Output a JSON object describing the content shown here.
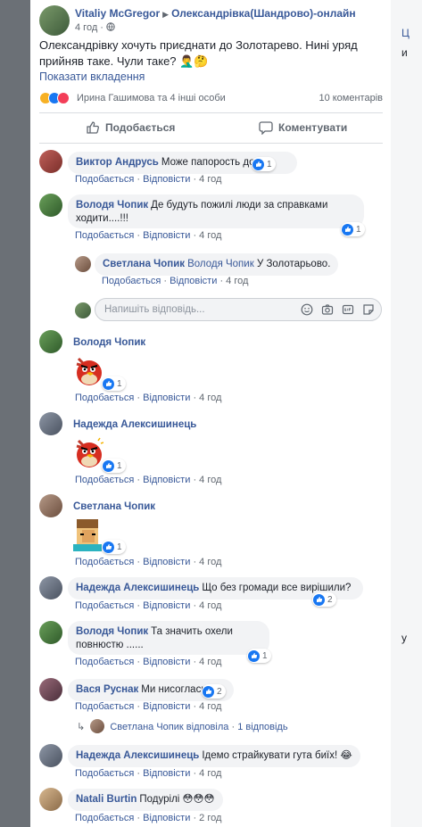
{
  "post": {
    "author": "Vitaliy McGregor",
    "group": "Олександрівка(Шандрово)-онлайн",
    "time": "4 год",
    "text": "Олександрівку хочуть приєднати до Золотарево. Нині уряд прийняв таке. Чули таке? 🤦‍♂️🤔",
    "show_attachments": "Показати вкладення",
    "reactions_names": "Ирина Гашимова та 4 інші особи",
    "comments_count": "10 коментарів",
    "like_label": "Подобається",
    "comment_label": "Коментувати"
  },
  "right_fragments": [
    "Ц",
    "и",
    "у"
  ],
  "links": {
    "like": "Подобається",
    "reply": "Відповісти",
    "dot": "·"
  },
  "comments": [
    {
      "author": "Виктор Андрусь",
      "text": "Може папорость до нас",
      "time": "4 год",
      "likes": "1"
    },
    {
      "author": "Володя Чопик",
      "text": "Де будуть пожилі люди за справками ходити....!!!",
      "time": "4 год",
      "likes": "1"
    },
    {
      "author": "Светлана Чопик",
      "mention": "Володя Чопик",
      "text": "У Золотарьово.",
      "time": "4 год"
    },
    {
      "author": "Володя Чопик",
      "time": "4 год",
      "likes": "1"
    },
    {
      "author": "Надежда Алексишинець",
      "time": "4 год",
      "likes": "1"
    },
    {
      "author": "Светлана Чопик",
      "time": "4 год",
      "likes": "1"
    },
    {
      "author": "Надежда Алексишинець",
      "text": "Що без громади все вирішили?",
      "time": "4 год",
      "likes": "2"
    },
    {
      "author": "Володя Чопик",
      "text": "Та значить охели повнюстю ......",
      "time": "4 год",
      "likes": "1"
    },
    {
      "author": "Вася Руснак",
      "text": "Ми нисогласни",
      "time": "4 год",
      "likes": "2"
    },
    {
      "author": "Надежда Алексишинець",
      "text": "Ідемо страйкувати гута биїх! 😂",
      "time": "4 год"
    },
    {
      "author": "Natali Burtin",
      "text": "Подурілі 😳😳😳",
      "time": "2 год"
    }
  ],
  "reply_placeholder": "Напишіть відповідь...",
  "replied_summary": {
    "name": "Светлана Чопик",
    "action": "відповіла",
    "count": "1 відповідь"
  },
  "colors": {
    "link": "#385898",
    "like_blue": "#1877f2",
    "bubble": "#f2f3f5"
  },
  "icons": [
    "globe-icon",
    "like-icon",
    "comment-icon",
    "emoji-icon",
    "camera-icon",
    "gif-icon",
    "sticker-icon",
    "reply-arrow-icon"
  ]
}
